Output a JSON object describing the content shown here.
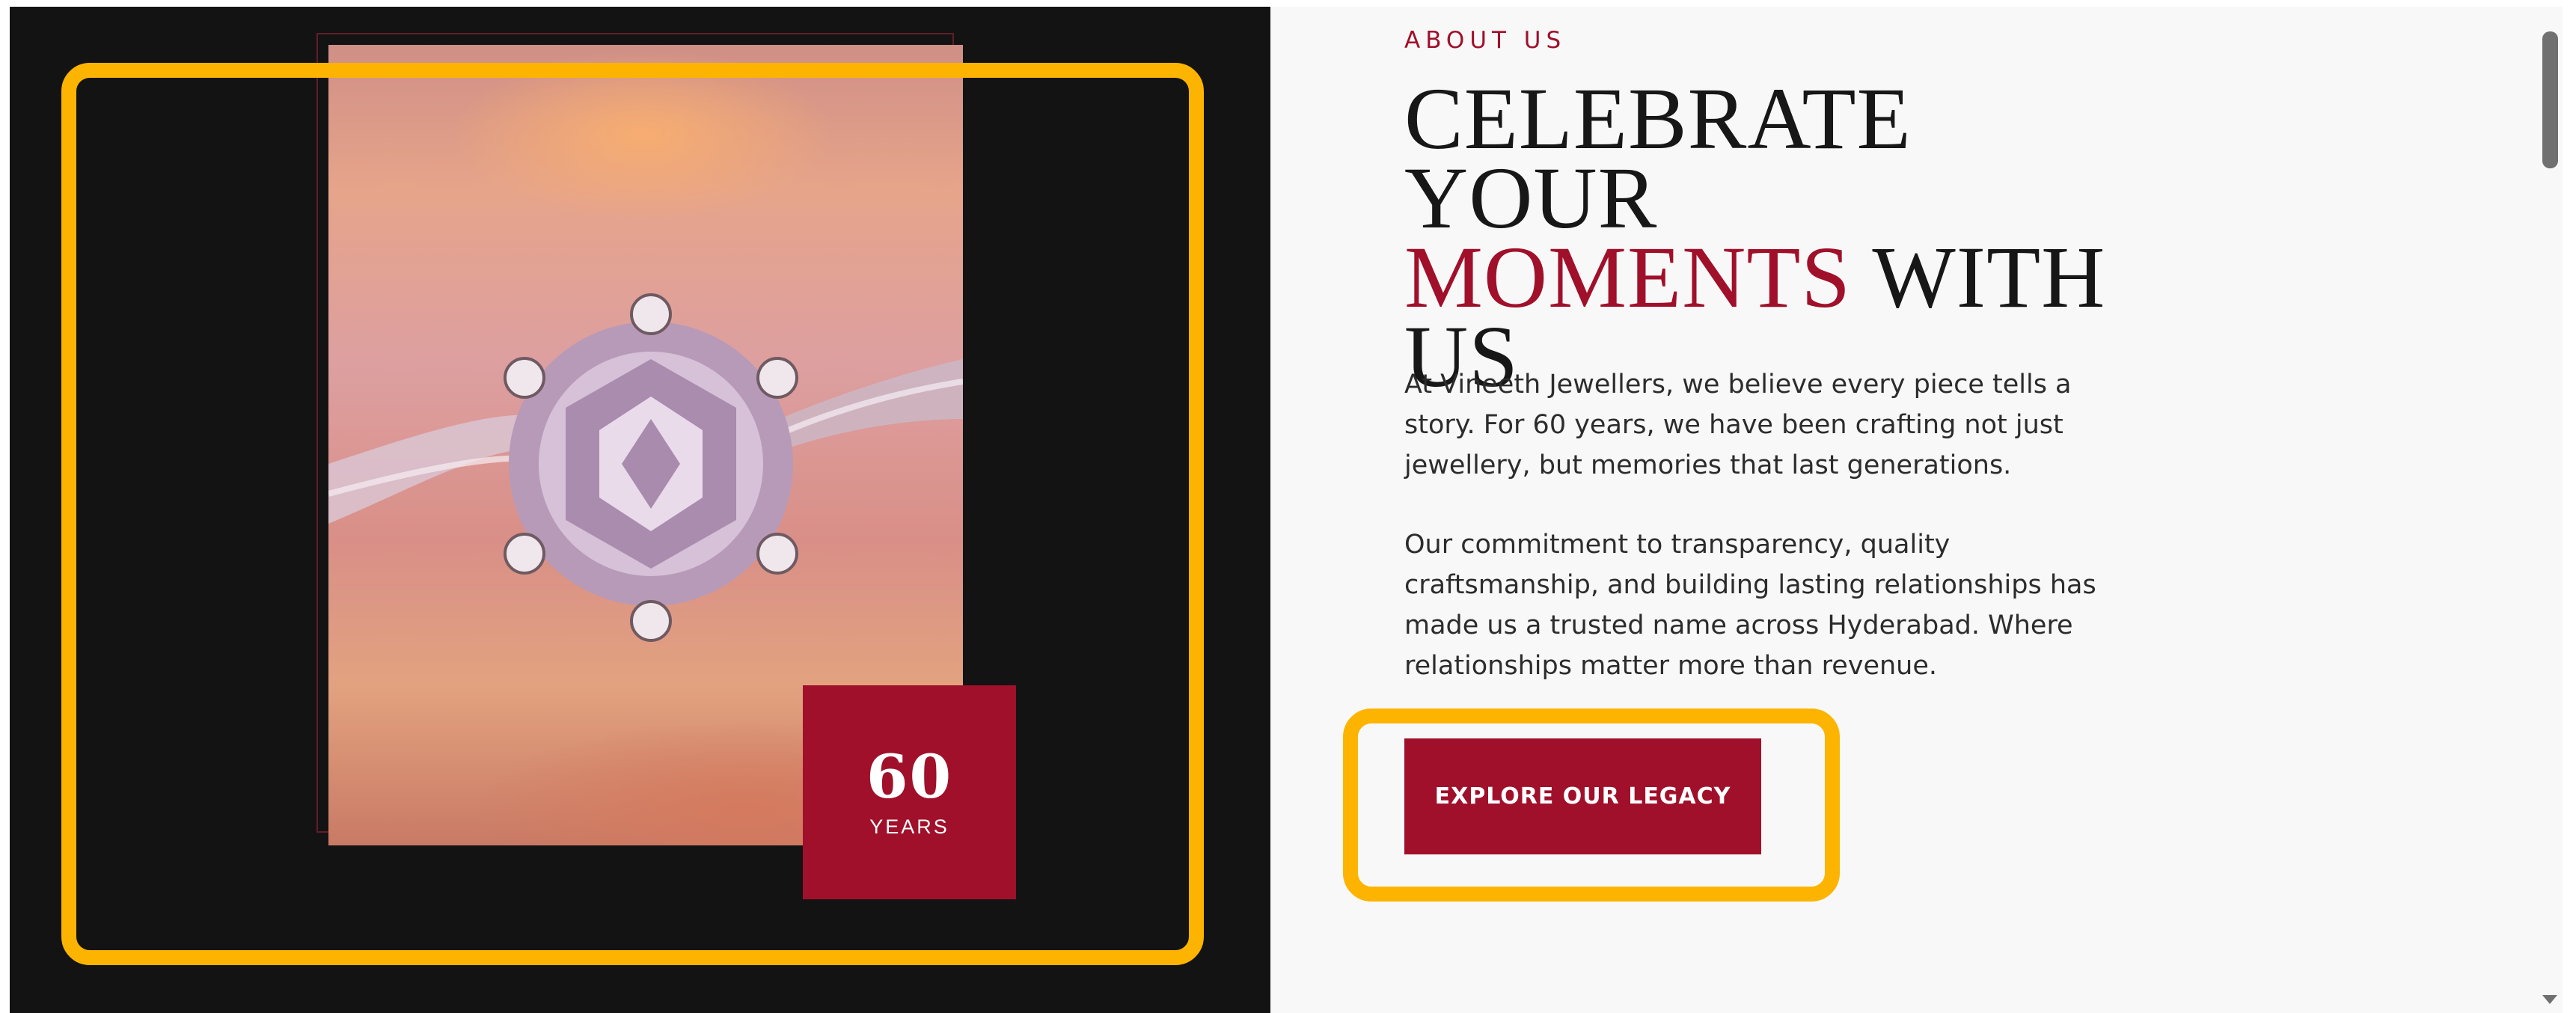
{
  "about": {
    "eyebrow": "ABOUT US",
    "headline_line1": "CELEBRATE YOUR",
    "headline_accent": "MOMENTS",
    "headline_line2_rest": " WITH",
    "headline_line3": "US",
    "paragraph1": "At Vineeth Jewellers, we believe every piece tells a story. For 60 years, we have been crafting not just jewellery, but memories that last generations.",
    "paragraph2": "Our commitment to transparency, quality craftsmanship, and building lasting relationships has made us a trusted name across Hyderabad. Where relationships matter more than revenue.",
    "cta_label": "EXPLORE OUR LEGACY"
  },
  "badge": {
    "number": "60",
    "label": "YEARS"
  },
  "image": {
    "subject": "diamond-ring"
  },
  "colors": {
    "accent": "#a0102a",
    "dark_panel": "#131313",
    "light_panel": "#f8f8f8",
    "highlight": "#fdb400"
  }
}
